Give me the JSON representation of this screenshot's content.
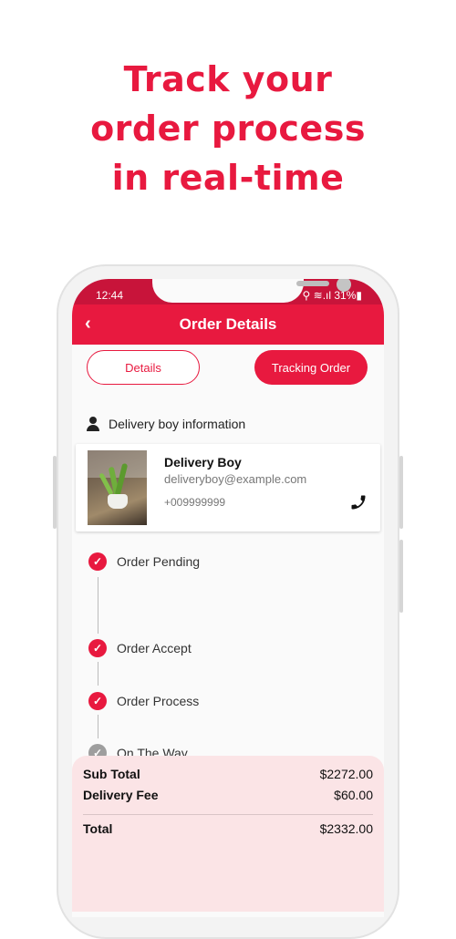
{
  "headline": {
    "line1": "Track your",
    "line2": "order process",
    "line3": "in real-time"
  },
  "status_bar": {
    "time": "12:44",
    "indicators": "⚲ ≋.ıl 31%▮"
  },
  "appbar": {
    "back_icon": "chevron-left-icon",
    "back_glyph": "‹",
    "title": "Order Details"
  },
  "tabs": [
    {
      "label": "Details",
      "selected": false
    },
    {
      "label": "Tracking Order",
      "selected": true
    }
  ],
  "delivery": {
    "section_title": "Delivery boy information",
    "name": "Delivery Boy",
    "email": "deliveryboy@example.com",
    "phone": "+009999999"
  },
  "steps": [
    {
      "label": "Order Pending",
      "done": true
    },
    {
      "label": "Order Accept",
      "done": true
    },
    {
      "label": "Order Process",
      "done": true
    },
    {
      "label": "On The Way",
      "done": false
    }
  ],
  "summary": {
    "sub_total_label": "Sub Total",
    "sub_total_value": "$2272.00",
    "delivery_fee_label": "Delivery Fee",
    "delivery_fee_value": "$60.00",
    "total_label": "Total",
    "total_value": "$2332.00"
  },
  "colors": {
    "accent": "#e8193f",
    "status_bar": "#c8143a",
    "summary_bg": "#fbe4e6",
    "inactive_step": "#9e9e9e"
  }
}
